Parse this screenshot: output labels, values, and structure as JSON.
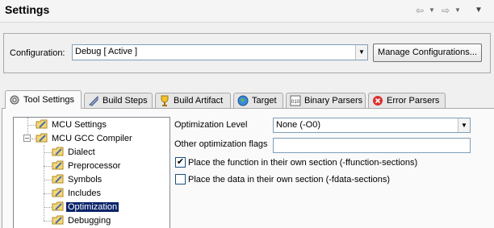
{
  "header": {
    "title": "Settings"
  },
  "configuration": {
    "label": "Configuration:",
    "selected": "Debug  [ Active ]",
    "manage_button": "Manage Configurations..."
  },
  "tabs": [
    {
      "label": "Tool Settings",
      "icon": "tool-settings-icon"
    },
    {
      "label": "Build Steps",
      "icon": "build-steps-icon"
    },
    {
      "label": "Build Artifact",
      "icon": "build-artifact-icon"
    },
    {
      "label": "Target",
      "icon": "target-icon"
    },
    {
      "label": "Binary Parsers",
      "icon": "binary-parsers-icon"
    },
    {
      "label": "Error Parsers",
      "icon": "error-parsers-icon"
    }
  ],
  "tree": {
    "items": [
      {
        "label": "MCU Settings"
      },
      {
        "label": "MCU GCC Compiler"
      },
      {
        "label": "Dialect"
      },
      {
        "label": "Preprocessor"
      },
      {
        "label": "Symbols"
      },
      {
        "label": "Includes"
      },
      {
        "label": "Optimization"
      },
      {
        "label": "Debugging"
      }
    ],
    "selected": "Optimization"
  },
  "options": {
    "optimization_level_label": "Optimization Level",
    "optimization_level_value": "None (-O0)",
    "other_flags_label": "Other optimization flags",
    "other_flags_value": "",
    "function_sections_label": "Place the function in their own section (-ffunction-sections)",
    "function_sections_checked": true,
    "data_sections_label": "Place the data in their own section (-fdata-sections)",
    "data_sections_checked": false
  },
  "colors": {
    "selection": "#0a246a",
    "error_red": "#d9302c",
    "accent_blue": "#1e73be"
  }
}
